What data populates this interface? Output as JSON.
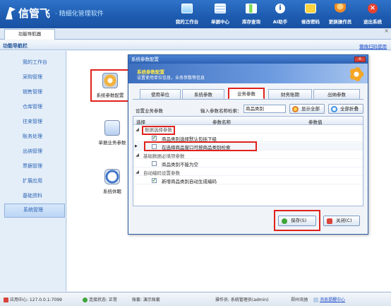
{
  "app": {
    "logo_text": "信管飞",
    "subtitle": "· 精细化管理软件",
    "toolbar": [
      {
        "label": "我的工作台",
        "icon": "monitor-icon"
      },
      {
        "label": "单据中心",
        "icon": "document-icon"
      },
      {
        "label": "库存查询",
        "icon": "chart-icon"
      },
      {
        "label": "AI助手",
        "icon": "info-icon"
      },
      {
        "label": "修改密码",
        "icon": "lock-icon"
      },
      {
        "label": "更换操作员",
        "icon": "user-icon"
      },
      {
        "label": "退出系统",
        "icon": "exit-icon"
      }
    ],
    "close_glyph": "×"
  },
  "tabs": {
    "nav_tab": "功能导航器"
  },
  "nav": {
    "header": "功能导航栏",
    "help_link": "懒做扫码使用",
    "items": [
      "我的工作台",
      "采购管理",
      "销售管理",
      "仓库管理",
      "往来管理",
      "账务处理",
      "出纳管理",
      "票据管理",
      "扩展应用",
      "基础资料",
      "系统管理"
    ],
    "selected": "系统管理"
  },
  "functions": [
    {
      "label": "系统参数配置",
      "icon": "database-icon"
    },
    {
      "label": "单据业务参数",
      "icon": "form-settings-icon"
    },
    {
      "label": "系统休眠",
      "icon": "clock-icon"
    }
  ],
  "dialog": {
    "title": "系统参数配置",
    "close_glyph": "✕",
    "banner_title": "系统参数配置",
    "banner_sub": "设置使用单位信息，业务参数等信息",
    "tabs": [
      "使用单位",
      "系统参数",
      "业务参数",
      "财务账期",
      "出纳参数"
    ],
    "active_tab": "业务参数",
    "set_label": "设置业务参数",
    "search_label": "输入参数名称检索：",
    "search_value": "商品类别",
    "btn_expand": "显示全部",
    "btn_collapse": "全部折叠",
    "grid": {
      "headers": {
        "select": "选择",
        "name": "参数名称",
        "value": "参数值"
      },
      "rows": [
        {
          "type": "group",
          "text": "数据选择参数"
        },
        {
          "type": "item",
          "checked": true,
          "text": "商品类别选择默认包括下级"
        },
        {
          "type": "item",
          "checked": false,
          "current": true,
          "text": "在选择商品窗口可按商品类别检索"
        },
        {
          "type": "group",
          "text": "基础数据必填项参数"
        },
        {
          "type": "item",
          "checked": false,
          "text": "商品类别不能为空"
        },
        {
          "type": "group",
          "text": "自动编码设置参数"
        },
        {
          "type": "item",
          "checked": true,
          "text": "新增商品类别自动生成编码"
        }
      ]
    },
    "btn_save": "保存(S)",
    "btn_close": "关闭(C)"
  },
  "status": {
    "center": "应用中心: 127.0.0.1:7099",
    "conn": "连接状态: 正常",
    "account": "账套: 演示账套",
    "operator": "操作员: 系统管理员(admin)",
    "company": "郑州讯驰",
    "message": "消息提醒中心"
  }
}
